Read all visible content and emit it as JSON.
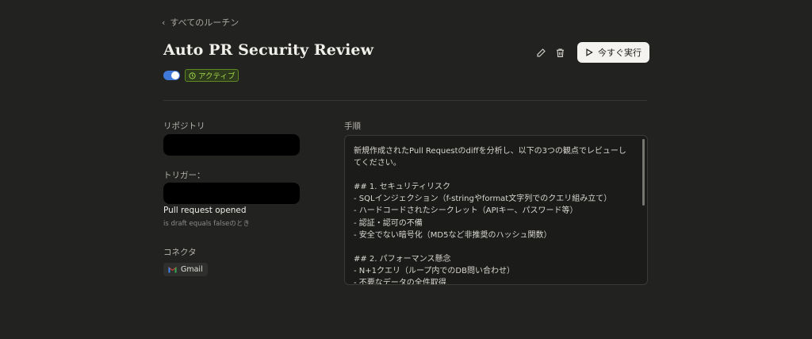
{
  "nav": {
    "back_label": "すべてのルーチン"
  },
  "routine": {
    "title": "Auto PR Security Review",
    "status": "アクティブ",
    "enabled": true
  },
  "actions": {
    "run_label": "今すぐ実行"
  },
  "sections": {
    "repository_label": "リポジトリ",
    "trigger_label": "トリガー：",
    "trigger_name": "Pull request opened",
    "trigger_condition": "is draft equals falseのとき",
    "connector_label": "コネクタ",
    "connectors": [
      "Gmail"
    ],
    "steps_label": "手順"
  },
  "steps": {
    "content": "新規作成されたPull Requestのdiffを分析し、以下の3つの観点でレビューしてください。\n\n## 1. セキュリティリスク\n- SQLインジェクション（f-stringやformat文字列でのクエリ組み立て）\n- ハードコードされたシークレット（APIキー、パスワード等）\n- 認証・認可の不備\n- 安全でない暗号化（MD5など非推奨のハッシュ関数）\n\n## 2. パフォーマンス懸念\n- N+1クエリ（ループ内でのDB問い合わせ）\n- 不要なデータの全件取得"
  },
  "colors": {
    "background": "#222221",
    "toggle_on": "#3f78d8",
    "badge_text": "#9fd34b",
    "badge_border": "#5e8a24"
  },
  "icons": [
    "chevron-left-icon",
    "pencil-icon",
    "trash-icon",
    "play-icon",
    "clock-icon",
    "gmail-icon"
  ]
}
